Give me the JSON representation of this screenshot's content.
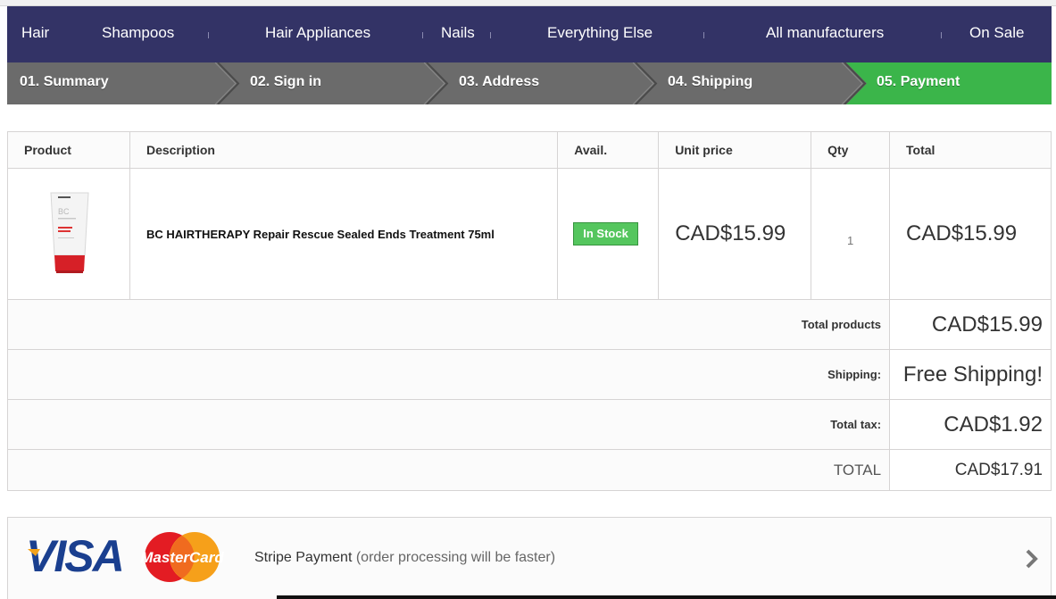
{
  "nav": {
    "items": [
      "Hair",
      "Shampoos",
      "Hair Appliances",
      "Nails",
      "Everything Else",
      "All manufacturers",
      "On Sale"
    ]
  },
  "steps": [
    {
      "label": "01. Summary",
      "state": "done"
    },
    {
      "label": "02. Sign in",
      "state": "done"
    },
    {
      "label": "03. Address",
      "state": "done"
    },
    {
      "label": "04. Shipping",
      "state": "done"
    },
    {
      "label": "05. Payment",
      "state": "current"
    }
  ],
  "colors": {
    "nav_bg": "#333366",
    "step_bg": "#6b6b6b",
    "step_current": "#3bb54a",
    "stock_badge": "#55c65e"
  },
  "cart": {
    "headers": {
      "product": "Product",
      "description": "Description",
      "avail": "Avail.",
      "unit_price": "Unit price",
      "qty": "Qty",
      "total": "Total"
    },
    "items": [
      {
        "image": "product-tube-icon",
        "description": "BC HAIRTHERAPY Repair Rescue Sealed Ends Treatment 75ml",
        "avail": "In Stock",
        "unit_price": "CAD$15.99",
        "qty": "1",
        "total": "CAD$15.99"
      }
    ],
    "summary": {
      "total_products_label": "Total products",
      "total_products_value": "CAD$15.99",
      "shipping_label": "Shipping:",
      "shipping_value": "Free Shipping!",
      "tax_label": "Total tax:",
      "tax_value": "CAD$1.92",
      "total_label": "TOTAL",
      "total_value": "CAD$17.91"
    }
  },
  "payment": {
    "logos": [
      "VISA",
      "MasterCard"
    ],
    "method": "Stripe Payment",
    "note": "(order processing will be faster)",
    "chevron_icon": "chevron-right-icon"
  }
}
